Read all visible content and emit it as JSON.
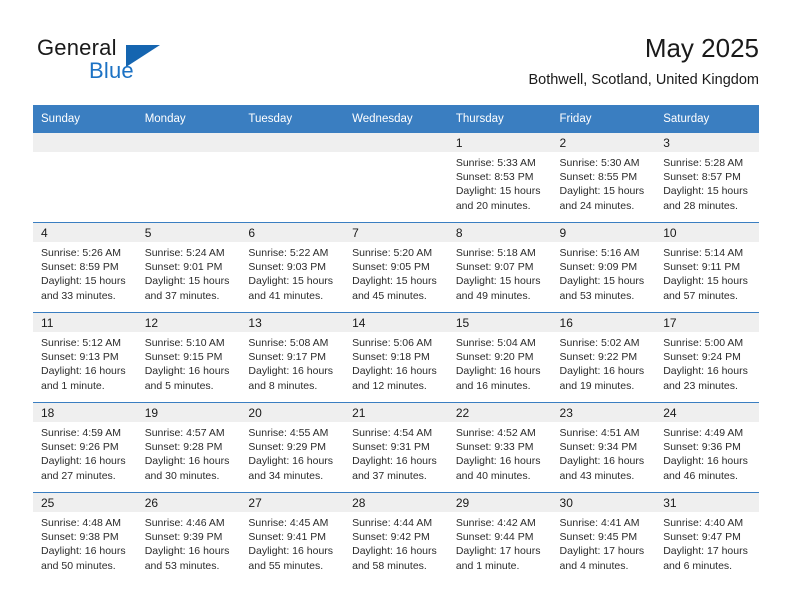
{
  "brand": {
    "word1": "General",
    "word2": "Blue",
    "triangle_color": "#1565b0",
    "blue_color": "#1c72c4"
  },
  "header": {
    "title": "May 2025",
    "subtitle": "Bothwell, Scotland, United Kingdom"
  },
  "theme": {
    "header_row_bg": "#3a7ec1",
    "daynum_band_bg": "#efefef",
    "grid_line": "#3a7ec1"
  },
  "weekdays": [
    "Sunday",
    "Monday",
    "Tuesday",
    "Wednesday",
    "Thursday",
    "Friday",
    "Saturday"
  ],
  "weeks": [
    [
      {
        "empty": true
      },
      {
        "empty": true
      },
      {
        "empty": true
      },
      {
        "empty": true
      },
      {
        "day": "1",
        "sunrise": "Sunrise: 5:33 AM",
        "sunset": "Sunset: 8:53 PM",
        "daylight1": "Daylight: 15 hours",
        "daylight2": "and 20 minutes."
      },
      {
        "day": "2",
        "sunrise": "Sunrise: 5:30 AM",
        "sunset": "Sunset: 8:55 PM",
        "daylight1": "Daylight: 15 hours",
        "daylight2": "and 24 minutes."
      },
      {
        "day": "3",
        "sunrise": "Sunrise: 5:28 AM",
        "sunset": "Sunset: 8:57 PM",
        "daylight1": "Daylight: 15 hours",
        "daylight2": "and 28 minutes."
      }
    ],
    [
      {
        "day": "4",
        "sunrise": "Sunrise: 5:26 AM",
        "sunset": "Sunset: 8:59 PM",
        "daylight1": "Daylight: 15 hours",
        "daylight2": "and 33 minutes."
      },
      {
        "day": "5",
        "sunrise": "Sunrise: 5:24 AM",
        "sunset": "Sunset: 9:01 PM",
        "daylight1": "Daylight: 15 hours",
        "daylight2": "and 37 minutes."
      },
      {
        "day": "6",
        "sunrise": "Sunrise: 5:22 AM",
        "sunset": "Sunset: 9:03 PM",
        "daylight1": "Daylight: 15 hours",
        "daylight2": "and 41 minutes."
      },
      {
        "day": "7",
        "sunrise": "Sunrise: 5:20 AM",
        "sunset": "Sunset: 9:05 PM",
        "daylight1": "Daylight: 15 hours",
        "daylight2": "and 45 minutes."
      },
      {
        "day": "8",
        "sunrise": "Sunrise: 5:18 AM",
        "sunset": "Sunset: 9:07 PM",
        "daylight1": "Daylight: 15 hours",
        "daylight2": "and 49 minutes."
      },
      {
        "day": "9",
        "sunrise": "Sunrise: 5:16 AM",
        "sunset": "Sunset: 9:09 PM",
        "daylight1": "Daylight: 15 hours",
        "daylight2": "and 53 minutes."
      },
      {
        "day": "10",
        "sunrise": "Sunrise: 5:14 AM",
        "sunset": "Sunset: 9:11 PM",
        "daylight1": "Daylight: 15 hours",
        "daylight2": "and 57 minutes."
      }
    ],
    [
      {
        "day": "11",
        "sunrise": "Sunrise: 5:12 AM",
        "sunset": "Sunset: 9:13 PM",
        "daylight1": "Daylight: 16 hours",
        "daylight2": "and 1 minute."
      },
      {
        "day": "12",
        "sunrise": "Sunrise: 5:10 AM",
        "sunset": "Sunset: 9:15 PM",
        "daylight1": "Daylight: 16 hours",
        "daylight2": "and 5 minutes."
      },
      {
        "day": "13",
        "sunrise": "Sunrise: 5:08 AM",
        "sunset": "Sunset: 9:17 PM",
        "daylight1": "Daylight: 16 hours",
        "daylight2": "and 8 minutes."
      },
      {
        "day": "14",
        "sunrise": "Sunrise: 5:06 AM",
        "sunset": "Sunset: 9:18 PM",
        "daylight1": "Daylight: 16 hours",
        "daylight2": "and 12 minutes."
      },
      {
        "day": "15",
        "sunrise": "Sunrise: 5:04 AM",
        "sunset": "Sunset: 9:20 PM",
        "daylight1": "Daylight: 16 hours",
        "daylight2": "and 16 minutes."
      },
      {
        "day": "16",
        "sunrise": "Sunrise: 5:02 AM",
        "sunset": "Sunset: 9:22 PM",
        "daylight1": "Daylight: 16 hours",
        "daylight2": "and 19 minutes."
      },
      {
        "day": "17",
        "sunrise": "Sunrise: 5:00 AM",
        "sunset": "Sunset: 9:24 PM",
        "daylight1": "Daylight: 16 hours",
        "daylight2": "and 23 minutes."
      }
    ],
    [
      {
        "day": "18",
        "sunrise": "Sunrise: 4:59 AM",
        "sunset": "Sunset: 9:26 PM",
        "daylight1": "Daylight: 16 hours",
        "daylight2": "and 27 minutes."
      },
      {
        "day": "19",
        "sunrise": "Sunrise: 4:57 AM",
        "sunset": "Sunset: 9:28 PM",
        "daylight1": "Daylight: 16 hours",
        "daylight2": "and 30 minutes."
      },
      {
        "day": "20",
        "sunrise": "Sunrise: 4:55 AM",
        "sunset": "Sunset: 9:29 PM",
        "daylight1": "Daylight: 16 hours",
        "daylight2": "and 34 minutes."
      },
      {
        "day": "21",
        "sunrise": "Sunrise: 4:54 AM",
        "sunset": "Sunset: 9:31 PM",
        "daylight1": "Daylight: 16 hours",
        "daylight2": "and 37 minutes."
      },
      {
        "day": "22",
        "sunrise": "Sunrise: 4:52 AM",
        "sunset": "Sunset: 9:33 PM",
        "daylight1": "Daylight: 16 hours",
        "daylight2": "and 40 minutes."
      },
      {
        "day": "23",
        "sunrise": "Sunrise: 4:51 AM",
        "sunset": "Sunset: 9:34 PM",
        "daylight1": "Daylight: 16 hours",
        "daylight2": "and 43 minutes."
      },
      {
        "day": "24",
        "sunrise": "Sunrise: 4:49 AM",
        "sunset": "Sunset: 9:36 PM",
        "daylight1": "Daylight: 16 hours",
        "daylight2": "and 46 minutes."
      }
    ],
    [
      {
        "day": "25",
        "sunrise": "Sunrise: 4:48 AM",
        "sunset": "Sunset: 9:38 PM",
        "daylight1": "Daylight: 16 hours",
        "daylight2": "and 50 minutes."
      },
      {
        "day": "26",
        "sunrise": "Sunrise: 4:46 AM",
        "sunset": "Sunset: 9:39 PM",
        "daylight1": "Daylight: 16 hours",
        "daylight2": "and 53 minutes."
      },
      {
        "day": "27",
        "sunrise": "Sunrise: 4:45 AM",
        "sunset": "Sunset: 9:41 PM",
        "daylight1": "Daylight: 16 hours",
        "daylight2": "and 55 minutes."
      },
      {
        "day": "28",
        "sunrise": "Sunrise: 4:44 AM",
        "sunset": "Sunset: 9:42 PM",
        "daylight1": "Daylight: 16 hours",
        "daylight2": "and 58 minutes."
      },
      {
        "day": "29",
        "sunrise": "Sunrise: 4:42 AM",
        "sunset": "Sunset: 9:44 PM",
        "daylight1": "Daylight: 17 hours",
        "daylight2": "and 1 minute."
      },
      {
        "day": "30",
        "sunrise": "Sunrise: 4:41 AM",
        "sunset": "Sunset: 9:45 PM",
        "daylight1": "Daylight: 17 hours",
        "daylight2": "and 4 minutes."
      },
      {
        "day": "31",
        "sunrise": "Sunrise: 4:40 AM",
        "sunset": "Sunset: 9:47 PM",
        "daylight1": "Daylight: 17 hours",
        "daylight2": "and 6 minutes."
      }
    ]
  ]
}
